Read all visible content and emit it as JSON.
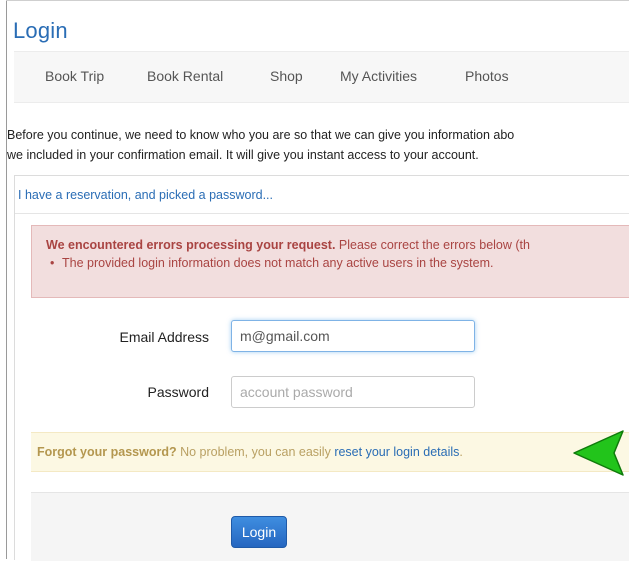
{
  "page": {
    "title": "Login"
  },
  "nav": {
    "items": [
      {
        "label": "Book Trip"
      },
      {
        "label": "Book Rental"
      },
      {
        "label": "Shop"
      },
      {
        "label": "My Activities"
      },
      {
        "label": "Photos"
      }
    ]
  },
  "intro": {
    "line1": "Before you continue, we need to know who you are so that we can give you information abo",
    "line2": "we included in your confirmation email. It will give you instant access to your account."
  },
  "panel": {
    "heading_link": "I have a reservation, and picked a password..."
  },
  "error_alert": {
    "title": "We encountered errors processing your request.",
    "detail": " Please correct the errors below (th",
    "bullet": "•",
    "item": "The provided login information does not match any active users in the system."
  },
  "form": {
    "email_label": "Email Address",
    "email_value": "m@gmail.com",
    "password_label": "Password",
    "password_placeholder": "account password",
    "login_button": "Login"
  },
  "forgot_alert": {
    "strong": "Forgot your password?",
    "text": " No problem, you can easily ",
    "link": "reset your login details",
    "period": "."
  },
  "icons": {
    "annotation_arrow": "green-arrow-icon"
  },
  "colors": {
    "link": "#2a6db5",
    "danger_bg": "#f2dede",
    "danger_text": "#a94442",
    "warning_bg": "#fcf8e3",
    "arrow_green": "#22c41b",
    "button_primary": "#2f7bd3"
  }
}
